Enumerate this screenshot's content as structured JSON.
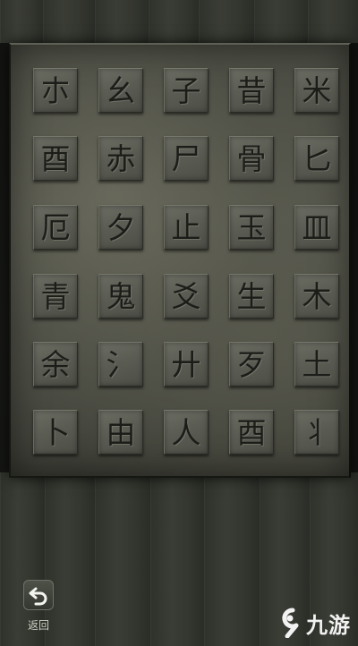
{
  "board": {
    "tiles": [
      [
        "朩",
        "幺",
        "子",
        "昔",
        "米"
      ],
      [
        "酉",
        "赤",
        "尸",
        "骨",
        "匕"
      ],
      [
        "厄",
        "夕",
        "止",
        "玉",
        "皿"
      ],
      [
        "青",
        "鬼",
        "爻",
        "生",
        "木"
      ],
      [
        "余",
        "氵",
        "廾",
        "歹",
        "土"
      ],
      [
        "卜",
        "由",
        "人",
        "酉",
        "丬"
      ]
    ]
  },
  "back": {
    "label": "返回",
    "icon": "back-arrow-icon"
  },
  "watermark": {
    "logo_glyph": "9",
    "text": "九游"
  }
}
